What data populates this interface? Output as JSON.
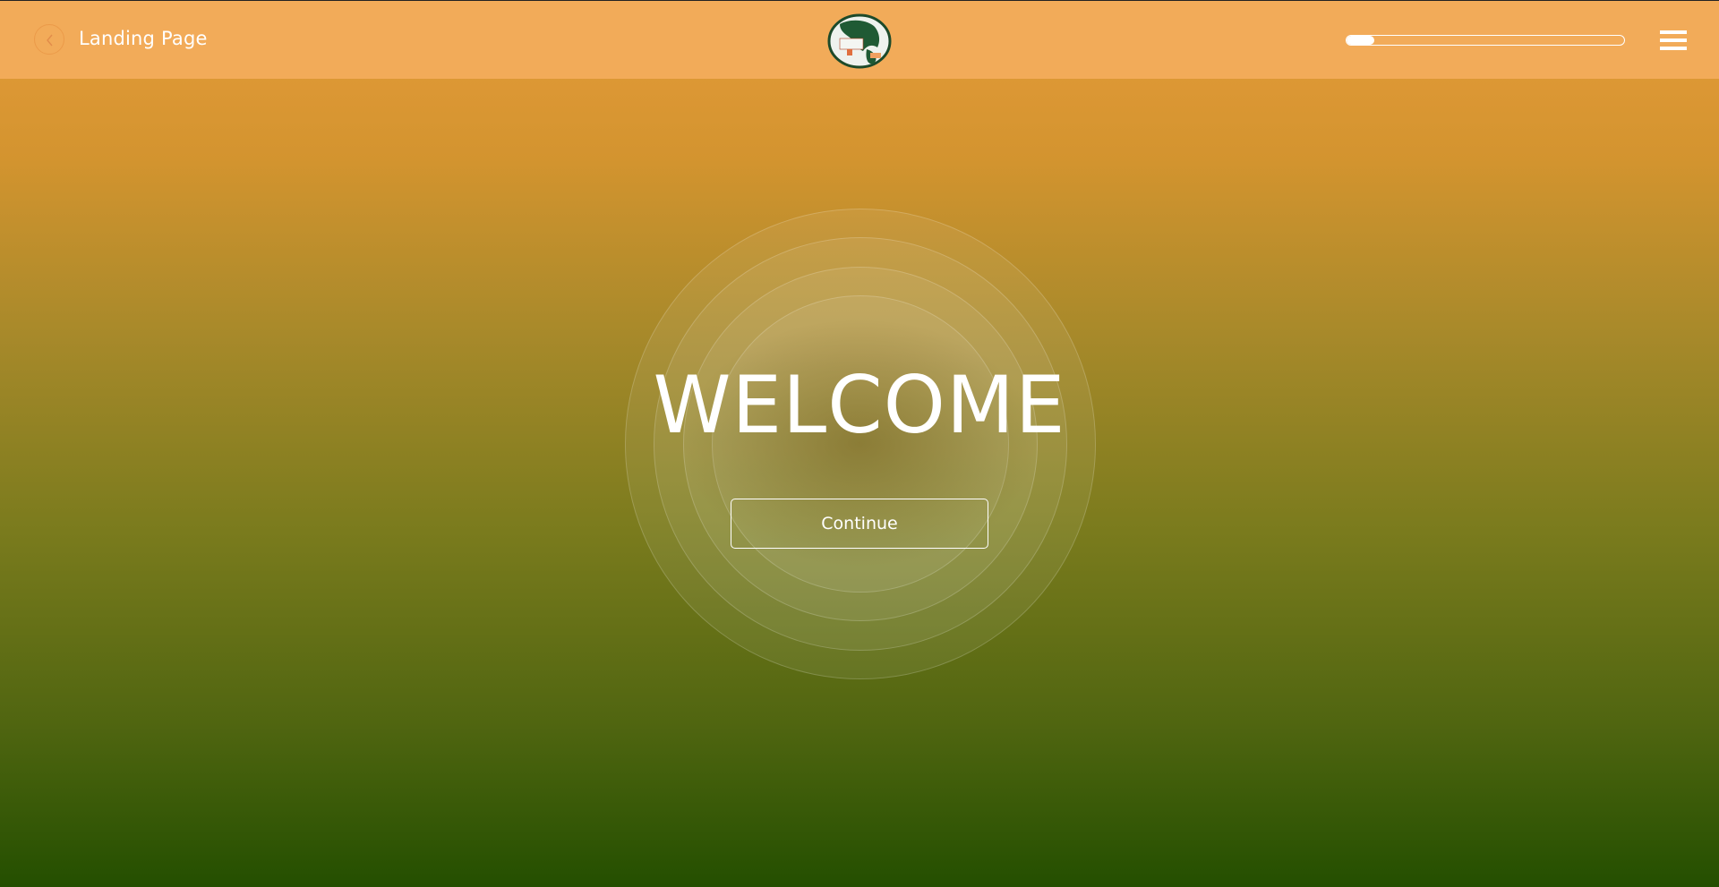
{
  "header": {
    "back_icon": "chevron-left-icon",
    "page_title": "Landing Page",
    "logo_icon": "globe-logo",
    "progress": 0.1,
    "menu_icon": "hamburger-menu-icon"
  },
  "main": {
    "heading": "WELCOME",
    "continue_label": "Continue"
  },
  "colors": {
    "header_bg": "#f2ab59",
    "gradient_top": "#e69b3a",
    "gradient_bottom": "#244f00",
    "text": "#ffffff"
  }
}
